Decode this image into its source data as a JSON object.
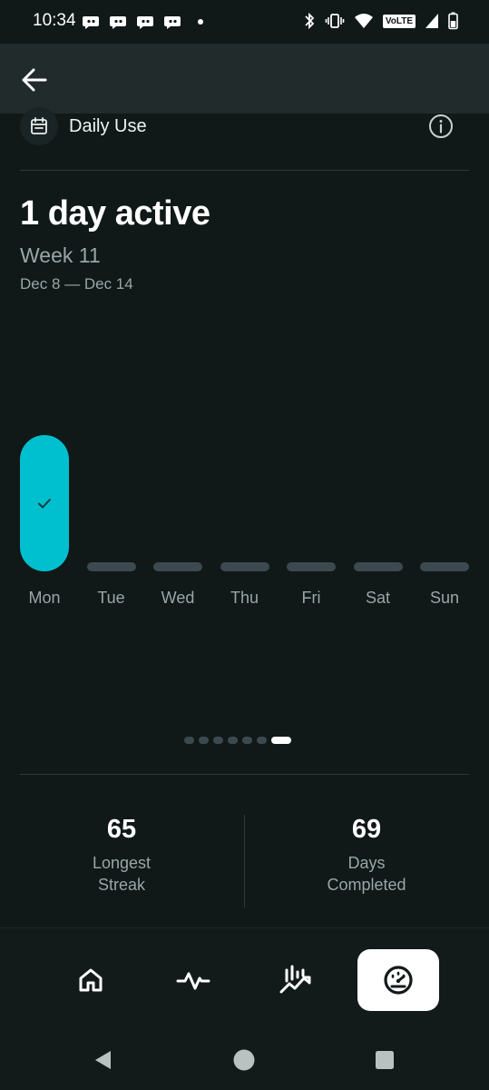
{
  "status_bar": {
    "time": "10:34",
    "volte": "VoLTE",
    "notification_icons": [
      "app-notification-icon",
      "app-notification-icon",
      "app-notification-icon",
      "app-notification-icon"
    ],
    "indicators": [
      "bluetooth-icon",
      "vibrate-icon",
      "wifi-icon",
      "volte-icon",
      "signal-icon",
      "battery-icon"
    ]
  },
  "header": {
    "back_icon": "arrow-left-icon"
  },
  "section": {
    "title": "Daily Use",
    "icon": "calendar-icon",
    "info_icon": "info-icon"
  },
  "summary": {
    "headline": "1 day active",
    "week": "Week 11",
    "date_range": "Dec 8 — Dec 14"
  },
  "chart_data": {
    "type": "bar",
    "categories": [
      "Mon",
      "Tue",
      "Wed",
      "Thu",
      "Fri",
      "Sat",
      "Sun"
    ],
    "values": [
      1,
      0,
      0,
      0,
      0,
      0,
      0
    ],
    "active_marker": "check-icon"
  },
  "pager": {
    "total": 7,
    "current": 7
  },
  "stats": {
    "longest_streak": {
      "value": "65",
      "label_line1": "Longest",
      "label_line2": "Streak"
    },
    "days_completed": {
      "value": "69",
      "label_line1": "Days",
      "label_line2": "Completed"
    }
  },
  "bottom_nav": {
    "items": [
      {
        "icon": "home-icon",
        "selected": false
      },
      {
        "icon": "activity-icon",
        "selected": false
      },
      {
        "icon": "trends-icon",
        "selected": false
      },
      {
        "icon": "dashboard-icon",
        "selected": true
      }
    ]
  },
  "colors": {
    "background": "#101818",
    "accent": "#00bfcf",
    "inactive_bar": "#3c4a50",
    "muted_text": "#9aa6a6"
  }
}
